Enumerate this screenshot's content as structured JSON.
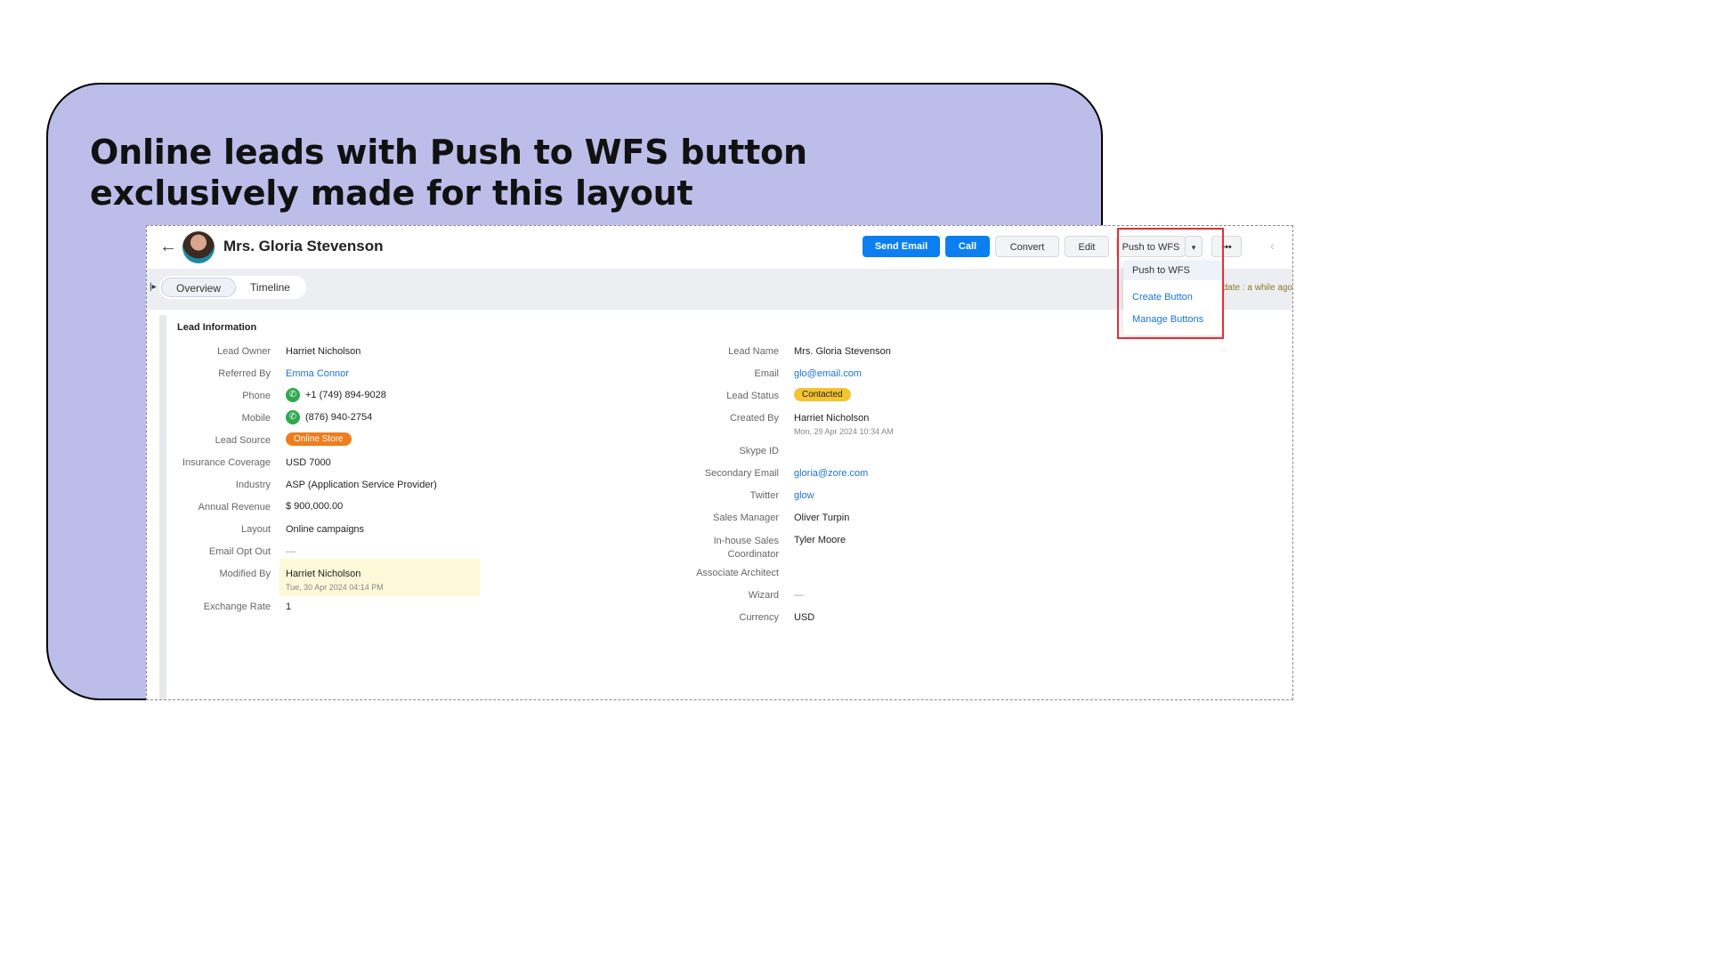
{
  "headline": {
    "line1": "Online leads with Push to WFS button",
    "line2": "exclusively made for this layout"
  },
  "record": {
    "title": "Mrs. Gloria Stevenson",
    "buttons": {
      "send_email": "Send Email",
      "call": "Call",
      "convert": "Convert",
      "edit": "Edit",
      "push_to_wfs": "Push to WFS",
      "more": "•••"
    },
    "tabs": [
      "Overview",
      "Timeline"
    ],
    "updated_text": "date : a while ago",
    "section_title": "Lead Information"
  },
  "left_fields": [
    {
      "label": "Lead Owner",
      "value": "Harriet Nicholson"
    },
    {
      "label": "Referred By",
      "value": "Emma Connor"
    },
    {
      "label": "Phone",
      "value": "+1 (749) 894-9028"
    },
    {
      "label": "Mobile",
      "value": "(876) 940-2754"
    },
    {
      "label": "Lead Source",
      "value": "Online Store"
    },
    {
      "label": "Insurance Coverage",
      "value": "USD 7000"
    },
    {
      "label": "Industry",
      "value": "ASP (Application Service Provider)"
    },
    {
      "label": "Annual Revenue",
      "value": "$ 900,000.00"
    },
    {
      "label": "Layout",
      "value": "Online campaigns"
    },
    {
      "label": "Email Opt Out",
      "value": "—"
    },
    {
      "label": "Modified By",
      "value": "Harriet Nicholson",
      "sub": "Tue, 30 Apr 2024 04:14 PM"
    },
    {
      "label": "Exchange Rate",
      "value": "1"
    }
  ],
  "right_fields": [
    {
      "label": "Lead Name",
      "value": "Mrs. Gloria Stevenson"
    },
    {
      "label": "Email",
      "value": "glo@email.com"
    },
    {
      "label": "Lead Status",
      "value": "Contacted"
    },
    {
      "label": "Created By",
      "value": "Harriet Nicholson",
      "sub": "Mon, 29 Apr 2024 10:34 AM"
    },
    {
      "label": "Skype ID",
      "value": ""
    },
    {
      "label": "Secondary Email",
      "value": "gloria@zore.com"
    },
    {
      "label": "Twitter",
      "value": "glow"
    },
    {
      "label": "Sales Manager",
      "value": "Oliver Turpin"
    },
    {
      "label": "In-house Sales",
      "label2": "Coordinator",
      "value": "Tyler Moore"
    },
    {
      "label": "Associate Architect",
      "value": ""
    },
    {
      "label": "Wizard",
      "value": "—"
    },
    {
      "label": "Currency",
      "value": "USD"
    }
  ],
  "dropdown": {
    "items": [
      "Push to WFS",
      "Create Button",
      "Manage Buttons"
    ]
  },
  "colors": {
    "panel": "#bcbde9",
    "primary": "#0b7ff0",
    "highlight_box": "#e0303a",
    "badge_orange": "#ef7d1d",
    "badge_yellow": "#f4c430"
  }
}
